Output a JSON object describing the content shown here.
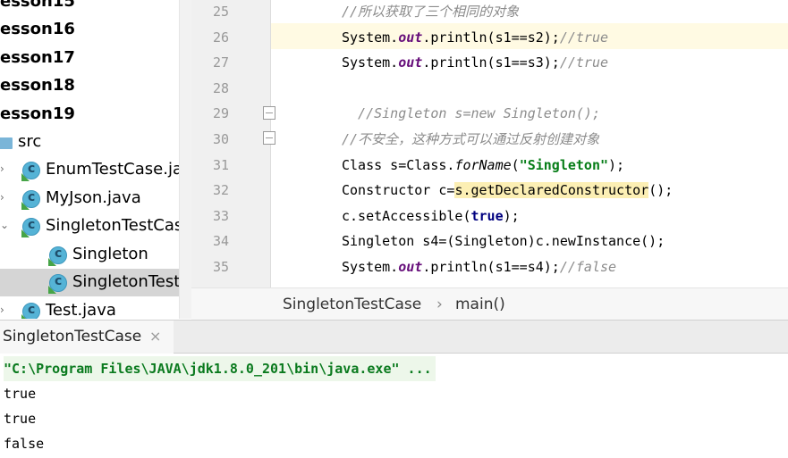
{
  "tree": {
    "items": [
      {
        "label": "esson15",
        "kind": "lesson"
      },
      {
        "label": "esson16",
        "kind": "lesson"
      },
      {
        "label": "esson17",
        "kind": "lesson"
      },
      {
        "label": "esson18",
        "kind": "lesson"
      },
      {
        "label": "esson19",
        "kind": "lesson"
      },
      {
        "label": "src",
        "kind": "folder"
      },
      {
        "label": "EnumTestCase.java",
        "kind": "class-file",
        "expander": "›"
      },
      {
        "label": "MyJson.java",
        "kind": "class-file",
        "expander": "›"
      },
      {
        "label": "SingletonTestCase.java",
        "kind": "class-file",
        "expander": "⌄"
      },
      {
        "label": "Singleton",
        "kind": "class"
      },
      {
        "label": "SingletonTestCase",
        "kind": "class",
        "selected": true
      },
      {
        "label": "Test.java",
        "kind": "class-file",
        "expander": "›"
      }
    ]
  },
  "editor": {
    "line_numbers": [
      "25",
      "26",
      "27",
      "28",
      "29",
      "30",
      "31",
      "32",
      "33",
      "34",
      "35"
    ],
    "current_line": "26",
    "lines": [
      [
        {
          "t": "//所以获取了三个相同的对象",
          "c": "cmt"
        }
      ],
      [
        {
          "t": "System.",
          "c": ""
        },
        {
          "t": "out",
          "c": "fld"
        },
        {
          "t": ".println(s1==s2);",
          "c": ""
        },
        {
          "t": "//true",
          "c": "cmt"
        }
      ],
      [
        {
          "t": "System.",
          "c": ""
        },
        {
          "t": "out",
          "c": "fld"
        },
        {
          "t": ".println(s1==s3);",
          "c": ""
        },
        {
          "t": "//true",
          "c": "cmt"
        }
      ],
      [],
      [
        {
          "t": "  //Singleton s=new Singleton();",
          "c": "cmt"
        }
      ],
      [
        {
          "t": "//不安全，这种方式可以通过反射创建对象",
          "c": "cmt"
        }
      ],
      [
        {
          "t": "Class s=Class.",
          "c": ""
        },
        {
          "t": "forName",
          "c": "mth"
        },
        {
          "t": "(",
          "c": ""
        },
        {
          "t": "\"Singleton\"",
          "c": "str"
        },
        {
          "t": ");",
          "c": ""
        }
      ],
      [
        {
          "t": "Constructor c=",
          "c": ""
        },
        {
          "t": "s.getDeclaredConstructor",
          "c": "hl"
        },
        {
          "t": "();",
          "c": ""
        }
      ],
      [
        {
          "t": "c.setAccessible(",
          "c": ""
        },
        {
          "t": "true",
          "c": "kw"
        },
        {
          "t": ");",
          "c": ""
        }
      ],
      [
        {
          "t": "Singleton s4=(Singleton)c.newInstance();",
          "c": ""
        }
      ],
      [
        {
          "t": "System.",
          "c": ""
        },
        {
          "t": "out",
          "c": "fld"
        },
        {
          "t": ".println(s1==s4);",
          "c": ""
        },
        {
          "t": "//false",
          "c": "cmt"
        }
      ]
    ]
  },
  "breadcrumb": {
    "class_name": "SingletonTestCase",
    "separator": "›",
    "method": "main()"
  },
  "run": {
    "tab_label": "SingletonTestCase",
    "close_glyph": "×",
    "command": "\"C:\\Program Files\\JAVA\\jdk1.8.0_201\\bin\\java.exe\" ...",
    "output": [
      "true",
      "true",
      "false"
    ]
  },
  "colors": {
    "current_line": "#fffae3",
    "comment": "#8c8c8c",
    "static_field": "#660e7a",
    "string": "#067d17",
    "keyword": "#000080",
    "selection_highlight": "#fcefb4"
  }
}
